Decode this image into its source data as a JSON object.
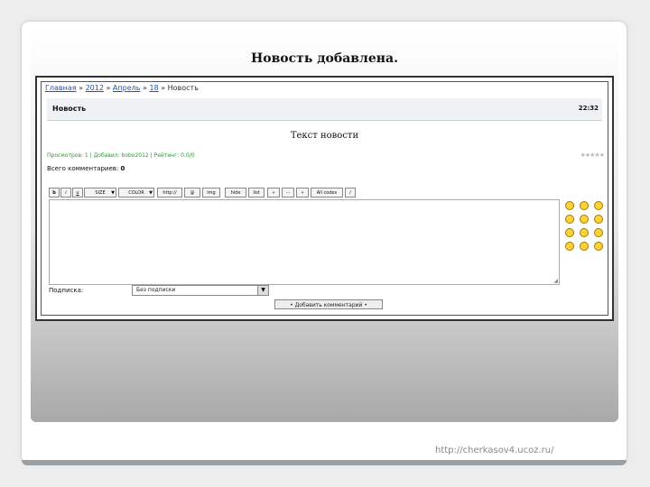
{
  "slide": {
    "title": "Новость добавлена.",
    "footer_url": "http://cherkasov4.ucoz.ru/"
  },
  "breadcrumb": {
    "home": "Главная",
    "sep": "»",
    "year": "2012",
    "month": "Апрель",
    "day": "18",
    "current": "Новость"
  },
  "news": {
    "title": "Новость",
    "time": "22:32",
    "text": "Текст новости",
    "meta": "Просмотров: 1 | Добавил: bobo2012 | Рейтинг: 0.0/0"
  },
  "comments": {
    "total_label": "Всего комментариев:",
    "total_value": "0"
  },
  "toolbar": {
    "b": "b",
    "i": "i",
    "u": "u",
    "size": "SIZE",
    "color": "COLOR",
    "http": "http://",
    "at": "@",
    "img": "img",
    "hide": "hide",
    "list": "list",
    "left": "«",
    "dots": "···",
    "right": "»",
    "all_codes": "All codes",
    "slash": "/"
  },
  "form": {
    "signature_label": "Подписка:",
    "signature_value": "Без подписки",
    "add_comment": "• Добавить комментарий •"
  },
  "colors": {
    "link": "#2255aa",
    "meta": "#2a9d2a",
    "smiley": "#ffd23a"
  }
}
